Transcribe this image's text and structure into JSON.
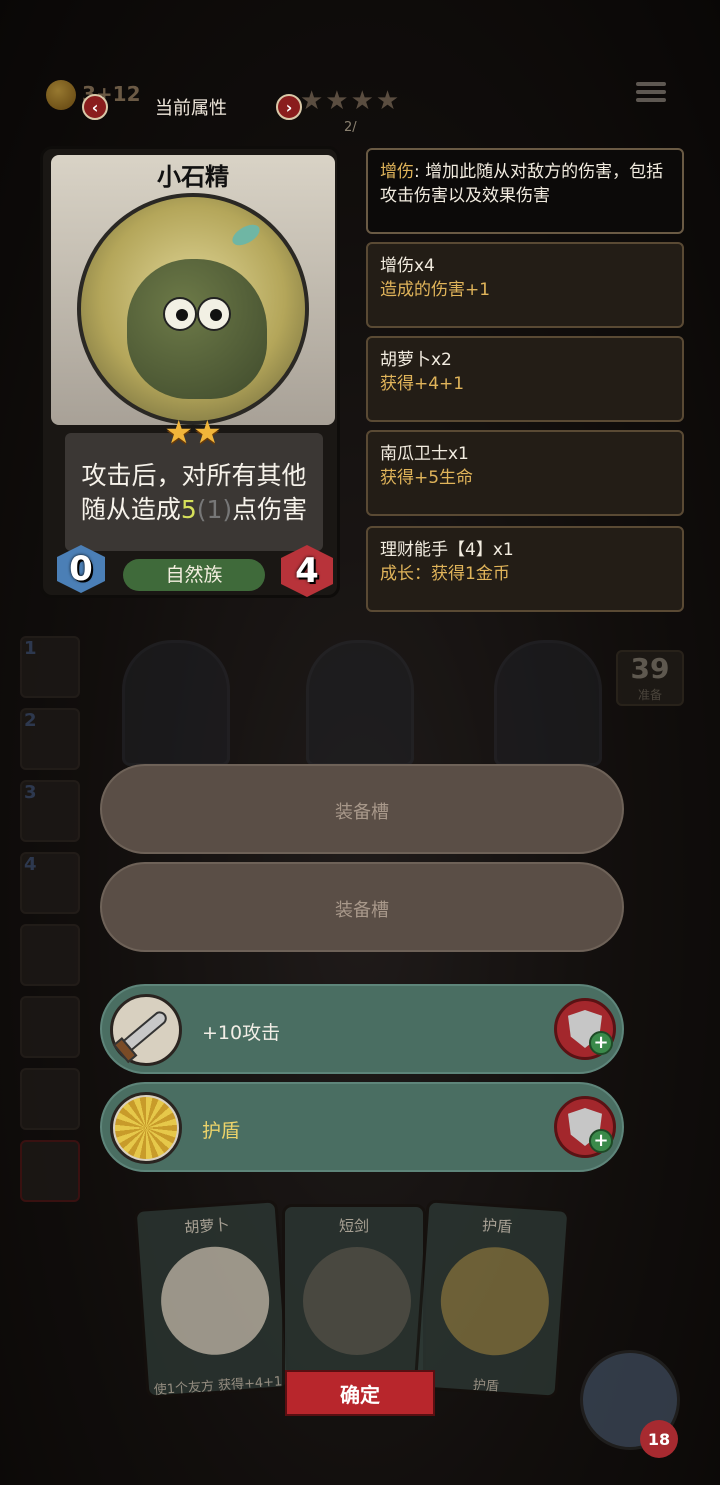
{
  "header": {
    "coins": "3+12",
    "title": "当前属性",
    "page": "2/",
    "prev_icon": "chevron-left-icon",
    "next_icon": "chevron-right-icon"
  },
  "card": {
    "name": "小石精",
    "stars": "★★",
    "desc_line1": "攻击后，对所有其他",
    "desc_line2_pre": "随从造成",
    "desc_value": "5",
    "desc_sub": "(1)",
    "desc_line2_post": "点伤害",
    "cost": "0",
    "tribe": "自然族",
    "health": "4"
  },
  "info_panels": [
    {
      "keyword": "增伤",
      "text": ": 增加此随从对敌方的伤害，包括攻击伤害以及效果伤害"
    },
    {
      "title": "增伤x4",
      "detail": "造成的伤害+1"
    },
    {
      "title": "胡萝卜x2",
      "detail": "获得+4+1"
    },
    {
      "title": "南瓜卫士x1",
      "detail": "获得+5生命"
    },
    {
      "title": "理财能手【4】x1",
      "detail": "成长：获得1金币"
    }
  ],
  "hero_list": [
    "1",
    "2",
    "3",
    "4"
  ],
  "counter": {
    "value": "39",
    "label": "准备"
  },
  "slots": [
    {
      "type": "empty",
      "label": "装备槽"
    },
    {
      "type": "empty",
      "label": "装备槽"
    },
    {
      "type": "item",
      "label": "+10攻击",
      "icon": "sword-icon"
    },
    {
      "type": "item",
      "label": "护盾",
      "icon": "shield-icon"
    }
  ],
  "hand": [
    {
      "title": "胡萝卜",
      "sub": "使1个友方 获得+4+1"
    },
    {
      "title": "短剑",
      "sub": ""
    },
    {
      "title": "护盾",
      "sub": "护盾"
    }
  ],
  "confirm_label": "确定",
  "hero_health": "18"
}
